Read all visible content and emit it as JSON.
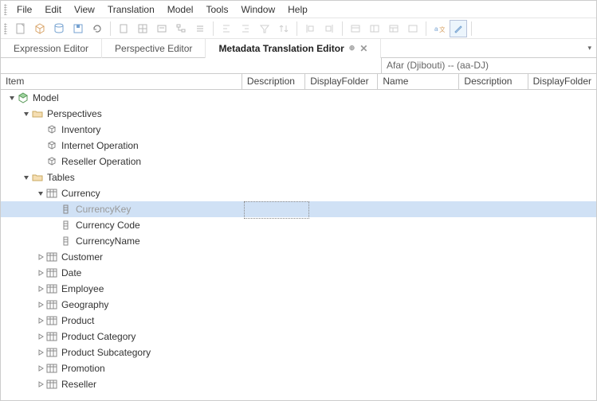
{
  "menu": {
    "items": [
      "File",
      "Edit",
      "View",
      "Translation",
      "Model",
      "Tools",
      "Window",
      "Help"
    ]
  },
  "tabs": {
    "items": [
      {
        "label": "Expression Editor",
        "active": false
      },
      {
        "label": "Perspective Editor",
        "active": false
      },
      {
        "label": "Metadata Translation Editor",
        "active": true
      }
    ]
  },
  "groupHeader": "Afar (Djibouti) -- (aa-DJ)",
  "columns": {
    "item": "Item",
    "desc": "Description",
    "disp": "DisplayFolder",
    "name": "Name",
    "desc2": "Description",
    "disp2": "DisplayFolder"
  },
  "tree": [
    {
      "d": 0,
      "exp": "open",
      "icon": "model",
      "label": "Model"
    },
    {
      "d": 1,
      "exp": "open",
      "icon": "folder",
      "label": "Perspectives"
    },
    {
      "d": 2,
      "exp": null,
      "icon": "persp",
      "label": "Inventory"
    },
    {
      "d": 2,
      "exp": null,
      "icon": "persp",
      "label": "Internet Operation"
    },
    {
      "d": 2,
      "exp": null,
      "icon": "persp",
      "label": "Reseller Operation"
    },
    {
      "d": 1,
      "exp": "open",
      "icon": "folder",
      "label": "Tables"
    },
    {
      "d": 2,
      "exp": "open",
      "icon": "table",
      "label": "Currency"
    },
    {
      "d": 3,
      "exp": null,
      "icon": "col",
      "label": "CurrencyKey",
      "selected": true,
      "disabled": true
    },
    {
      "d": 3,
      "exp": null,
      "icon": "col",
      "label": "Currency Code"
    },
    {
      "d": 3,
      "exp": null,
      "icon": "col",
      "label": "CurrencyName"
    },
    {
      "d": 2,
      "exp": "closed",
      "icon": "table",
      "label": "Customer"
    },
    {
      "d": 2,
      "exp": "closed",
      "icon": "table",
      "label": "Date"
    },
    {
      "d": 2,
      "exp": "closed",
      "icon": "table",
      "label": "Employee"
    },
    {
      "d": 2,
      "exp": "closed",
      "icon": "table",
      "label": "Geography"
    },
    {
      "d": 2,
      "exp": "closed",
      "icon": "table",
      "label": "Product"
    },
    {
      "d": 2,
      "exp": "closed",
      "icon": "table",
      "label": "Product Category"
    },
    {
      "d": 2,
      "exp": "closed",
      "icon": "table",
      "label": "Product Subcategory"
    },
    {
      "d": 2,
      "exp": "closed",
      "icon": "table",
      "label": "Promotion"
    },
    {
      "d": 2,
      "exp": "closed",
      "icon": "table",
      "label": "Reseller"
    }
  ]
}
